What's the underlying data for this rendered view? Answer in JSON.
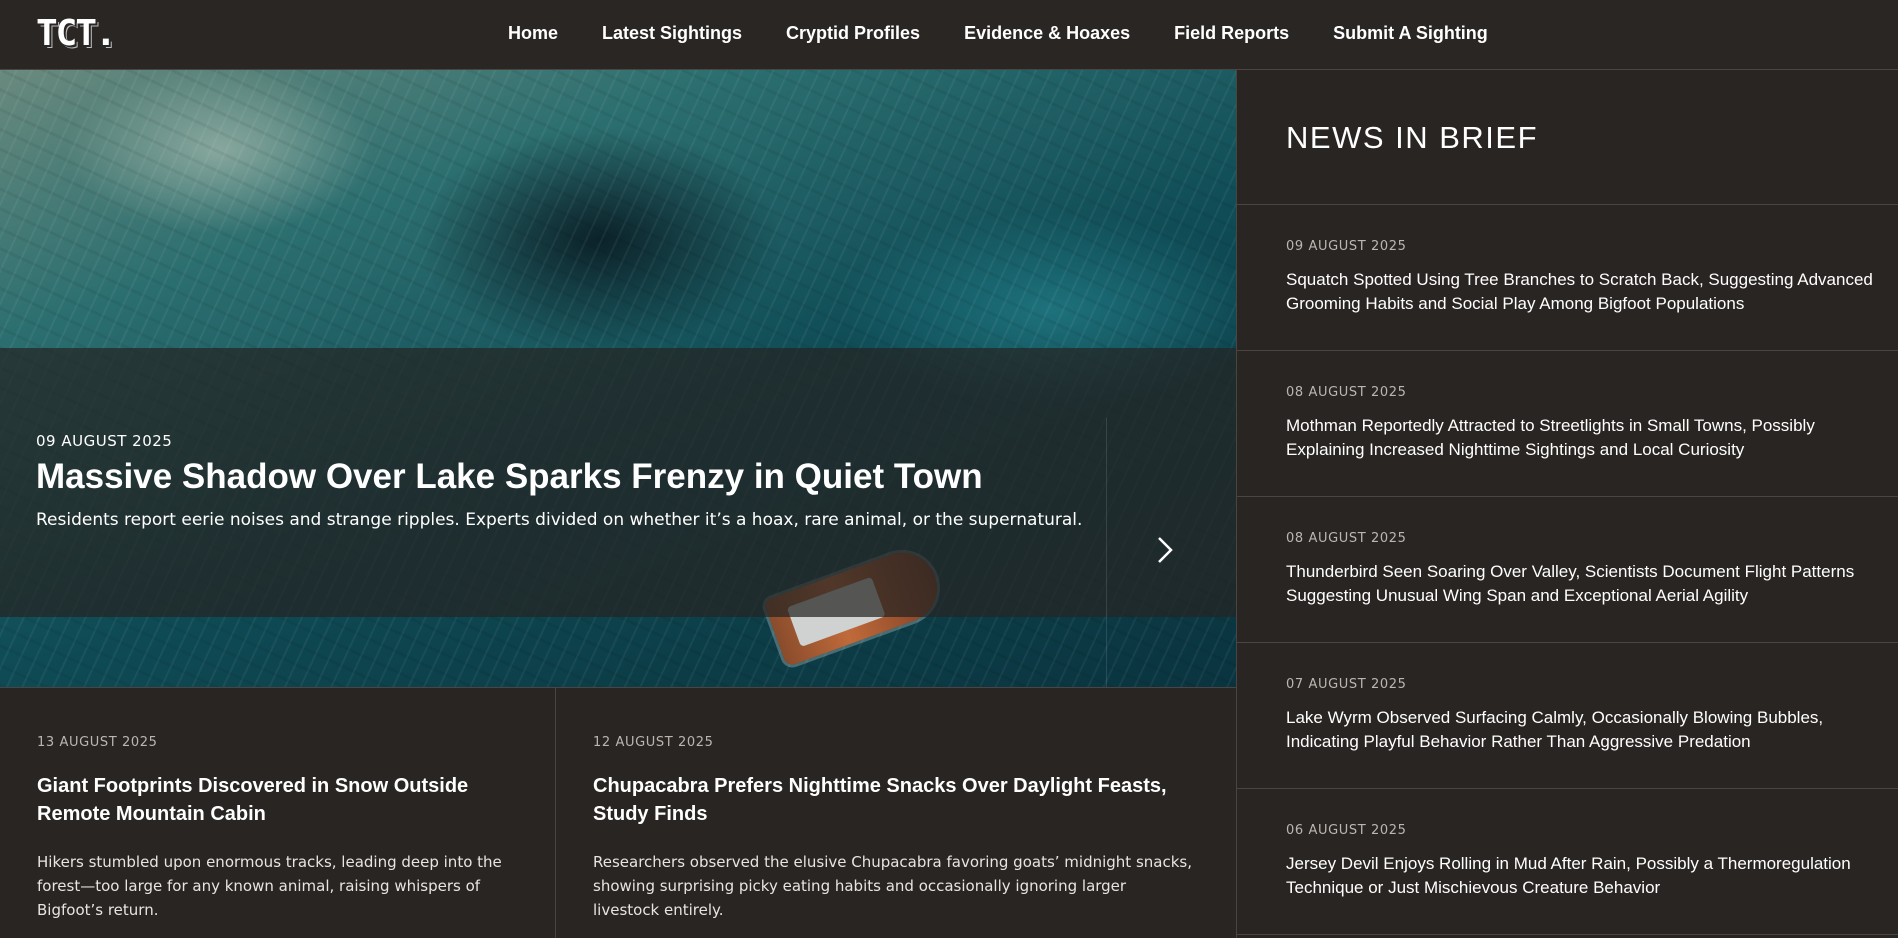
{
  "header": {
    "logo": "TCT.",
    "nav": [
      "Home",
      "Latest Sightings",
      "Cryptid Profiles",
      "Evidence & Hoaxes",
      "Field Reports",
      "Submit A Sighting"
    ]
  },
  "hero": {
    "date": "09 AUGUST 2025",
    "title": "Massive Shadow Over Lake Sparks Frenzy in Quiet Town",
    "subtitle": "Residents report eerie noises and strange ripples. Experts divided on whether it’s a hoax, rare animal, or the supernatural.",
    "next_icon": "chevron-right-icon"
  },
  "articles": [
    {
      "date": "13 AUGUST 2025",
      "title": "Giant Footprints Discovered in Snow Outside Remote Mountain Cabin",
      "excerpt": "Hikers stumbled upon enormous tracks, leading deep into the forest—too large for any known animal, raising whispers of Bigfoot’s return."
    },
    {
      "date": "12 AUGUST 2025",
      "title": "Chupacabra Prefers Nighttime Snacks Over Daylight Feasts, Study Finds",
      "excerpt": "Researchers observed the elusive Chupacabra favoring goats’ midnight snacks, showing surprising picky eating habits and occasionally ignoring larger livestock entirely."
    }
  ],
  "news_in_brief": {
    "heading": "NEWS IN BRIEF",
    "items": [
      {
        "date": "09 AUGUST 2025",
        "title": "Squatch Spotted Using Tree Branches to Scratch Back, Suggesting Advanced Grooming Habits and Social Play Among Bigfoot Populations"
      },
      {
        "date": "08 AUGUST 2025",
        "title": "Mothman Reportedly Attracted to Streetlights in Small Towns, Possibly Explaining Increased Nighttime Sightings and Local Curiosity"
      },
      {
        "date": "08 AUGUST 2025",
        "title": "Thunderbird Seen Soaring Over Valley, Scientists Document Flight Patterns Suggesting Unusual Wing Span and Exceptional Aerial Agility"
      },
      {
        "date": "07 AUGUST 2025",
        "title": "Lake Wyrm Observed Surfacing Calmly, Occasionally Blowing Bubbles, Indicating Playful Behavior Rather Than Aggressive Predation"
      },
      {
        "date": "06 AUGUST 2025",
        "title": "Jersey Devil Enjoys Rolling in Mud After Rain, Possibly a Thermoregulation Technique or Just Mischievous Creature Behavior"
      }
    ]
  }
}
